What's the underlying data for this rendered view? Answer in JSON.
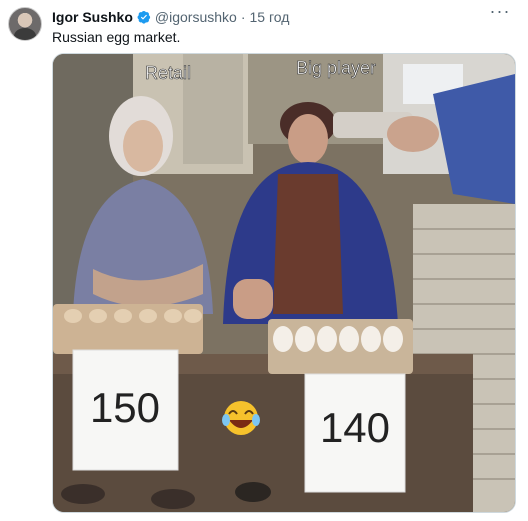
{
  "tweet": {
    "author_name": "Igor Sushko",
    "handle": "@igorsushko",
    "separator": "·",
    "time": "15 год",
    "more_icon": "ellipsis-icon",
    "text": "Russian egg market."
  },
  "media": {
    "caption_left": "Retail",
    "caption_right": "Big player",
    "price_left": "150",
    "price_right": "140",
    "emoji_icon": "laughing-emoji-icon"
  }
}
